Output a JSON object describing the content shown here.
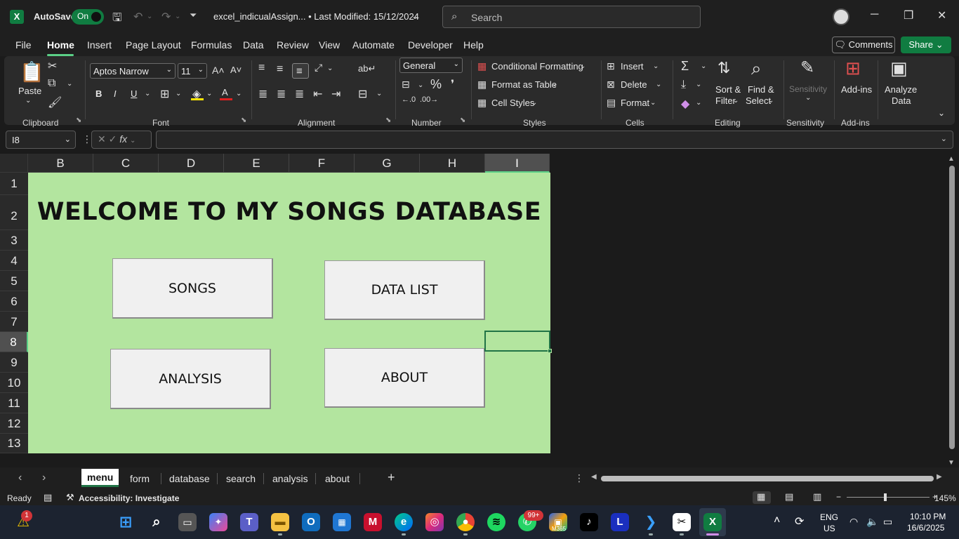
{
  "titlebar": {
    "autosave_label": "AutoSave",
    "autosave_state": "On",
    "doc_title": "excel_indicualAssign...  •  Last Modified: 15/12/2024",
    "search_placeholder": "Search"
  },
  "menu": {
    "items": [
      "File",
      "Home",
      "Insert",
      "Page Layout",
      "Formulas",
      "Data",
      "Review",
      "View",
      "Automate",
      "Developer",
      "Help"
    ],
    "active": "Home",
    "comments_label": "Comments",
    "share_label": "Share"
  },
  "ribbon": {
    "clipboard": {
      "paste_label": "Paste",
      "group_label": "Clipboard"
    },
    "font": {
      "family": "Aptos Narrow",
      "size": "11",
      "group_label": "Font"
    },
    "alignment": {
      "group_label": "Alignment"
    },
    "number": {
      "format": "General",
      "group_label": "Number"
    },
    "styles": {
      "conditional": "Conditional Formatting",
      "format_table": "Format as Table",
      "cell_styles": "Cell Styles",
      "group_label": "Styles"
    },
    "cells": {
      "insert": "Insert",
      "delete": "Delete",
      "format": "Format",
      "group_label": "Cells"
    },
    "editing": {
      "sort_filter_1": "Sort &",
      "sort_filter_2": "Filter",
      "find_select_1": "Find &",
      "find_select_2": "Select",
      "group_label": "Editing"
    },
    "sensitivity": {
      "label": "Sensitivity",
      "group_label": "Sensitivity"
    },
    "addins": {
      "label": "Add-ins",
      "group_label": "Add-ins"
    },
    "analyze": {
      "label_1": "Analyze",
      "label_2": "Data"
    }
  },
  "formula_bar": {
    "name_box": "I8",
    "formula": ""
  },
  "grid": {
    "columns": [
      "B",
      "C",
      "D",
      "E",
      "F",
      "G",
      "H",
      "I"
    ],
    "selected_column": "I",
    "rows": [
      "1",
      "2",
      "3",
      "4",
      "5",
      "6",
      "7",
      "8",
      "9",
      "10",
      "11",
      "12",
      "13"
    ],
    "selected_row": "8"
  },
  "sheet": {
    "title": "WELCOME TO MY SONGS DATABASE",
    "buttons": {
      "songs": "SONGS",
      "data_list": "DATA LIST",
      "analysis": "ANALYSIS",
      "about": "ABOUT"
    },
    "background_color": "#b3e59f"
  },
  "tabs": {
    "items": [
      "menu",
      "form",
      "database",
      "search",
      "analysis",
      "about"
    ],
    "active": "menu"
  },
  "statusbar": {
    "ready": "Ready",
    "accessibility": "Accessibility: Investigate",
    "zoom": "145%"
  },
  "taskbar": {
    "language_1": "ENG",
    "language_2": "US",
    "time": "10:10 PM",
    "date": "16/6/2025",
    "whatsapp_badge": "99+",
    "alert_badge": "1",
    "m365_label": "M365"
  }
}
